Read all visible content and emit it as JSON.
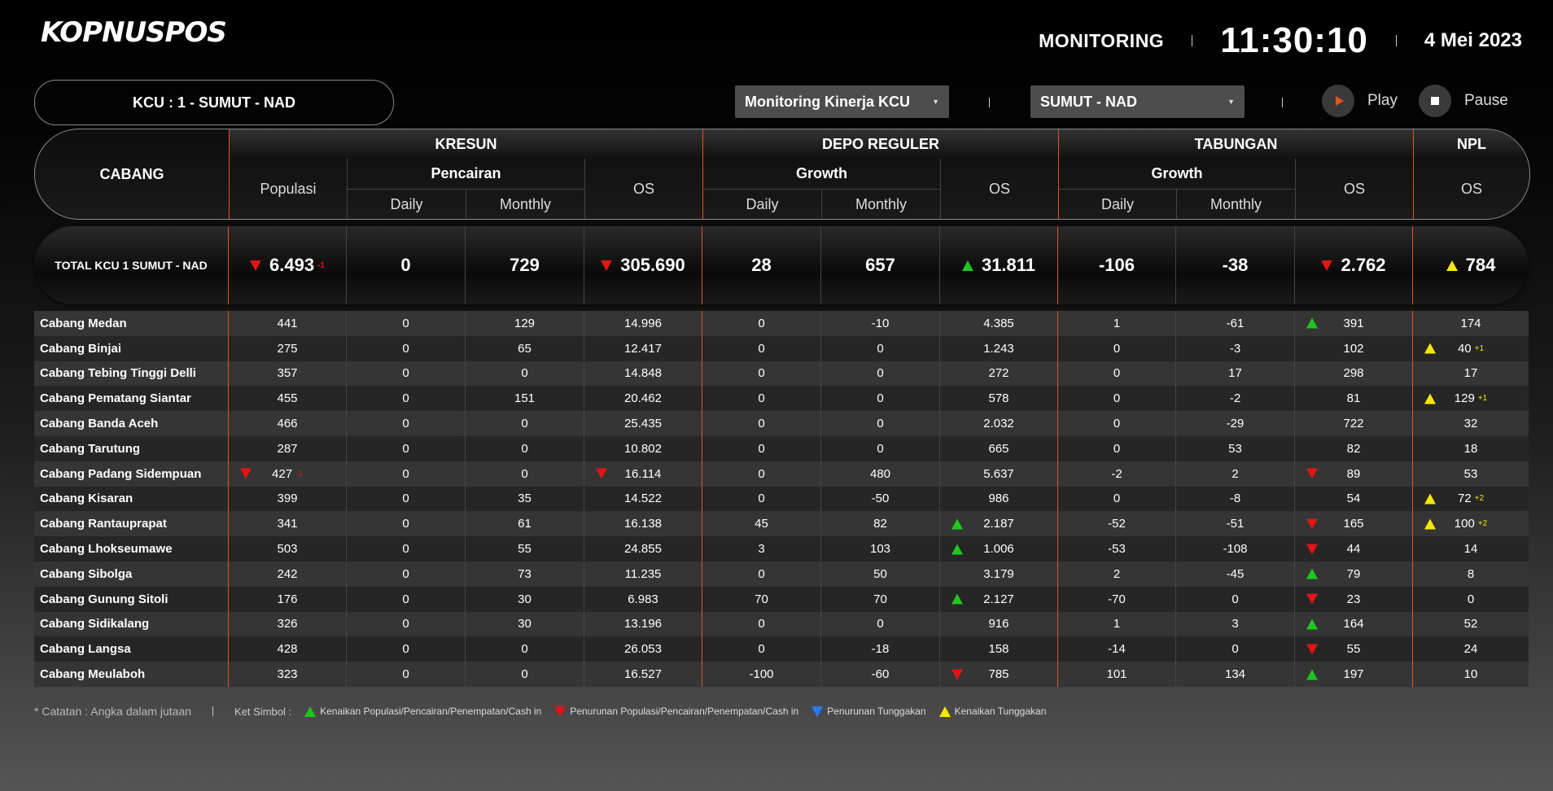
{
  "header": {
    "logo": "KOPNUSPOS",
    "monitoring_label": "MONITORING",
    "clock": "11:30:10",
    "date": "4 Mei 2023"
  },
  "toolbar": {
    "kcu_label": "KCU : 1 - SUMUT - NAD",
    "view_select": "Monitoring Kinerja KCU",
    "region_select": "SUMUT - NAD",
    "play_label": "Play",
    "pause_label": "Pause"
  },
  "table_header": {
    "cabang": "CABANG",
    "kresun": "KRESUN",
    "depo_reguler": "DEPO REGULER",
    "tabungan": "TABUNGAN",
    "npl": "NPL",
    "populasi": "Populasi",
    "pencairan": "Pencairan",
    "growth_depo": "Growth",
    "growth_tab": "Growth",
    "os": "OS",
    "daily": "Daily",
    "monthly": "Monthly"
  },
  "total": {
    "label": "TOTAL KCU 1 SUMUT - NAD",
    "values": [
      {
        "v": "6.493",
        "ind": "dn",
        "d": "-1"
      },
      {
        "v": "0"
      },
      {
        "v": "729"
      },
      {
        "v": "305.690",
        "ind": "dn"
      },
      {
        "v": "28"
      },
      {
        "v": "657"
      },
      {
        "v": "31.811",
        "ind": "up"
      },
      {
        "v": "-106"
      },
      {
        "v": "-38"
      },
      {
        "v": "2.762",
        "ind": "dn"
      },
      {
        "v": "784",
        "ind": "yl"
      }
    ]
  },
  "rows": [
    {
      "name": "Cabang Medan",
      "c": [
        {
          "v": "441"
        },
        {
          "v": "0"
        },
        {
          "v": "129"
        },
        {
          "v": "14.996"
        },
        {
          "v": "0"
        },
        {
          "v": "-10"
        },
        {
          "v": "4.385"
        },
        {
          "v": "1"
        },
        {
          "v": "-61"
        },
        {
          "v": "391",
          "ind": "up"
        },
        {
          "v": "174"
        }
      ]
    },
    {
      "name": "Cabang Binjai",
      "c": [
        {
          "v": "275"
        },
        {
          "v": "0"
        },
        {
          "v": "65"
        },
        {
          "v": "12.417"
        },
        {
          "v": "0"
        },
        {
          "v": "0"
        },
        {
          "v": "1.243"
        },
        {
          "v": "0"
        },
        {
          "v": "-3"
        },
        {
          "v": "102"
        },
        {
          "v": "40",
          "ind": "yl",
          "d": "+1"
        }
      ]
    },
    {
      "name": "Cabang Tebing Tinggi Delli",
      "c": [
        {
          "v": "357"
        },
        {
          "v": "0"
        },
        {
          "v": "0"
        },
        {
          "v": "14.848"
        },
        {
          "v": "0"
        },
        {
          "v": "0"
        },
        {
          "v": "272"
        },
        {
          "v": "0"
        },
        {
          "v": "17"
        },
        {
          "v": "298"
        },
        {
          "v": "17"
        }
      ]
    },
    {
      "name": "Cabang Pematang Siantar",
      "c": [
        {
          "v": "455"
        },
        {
          "v": "0"
        },
        {
          "v": "151"
        },
        {
          "v": "20.462"
        },
        {
          "v": "0"
        },
        {
          "v": "0"
        },
        {
          "v": "578"
        },
        {
          "v": "0"
        },
        {
          "v": "-2"
        },
        {
          "v": "81"
        },
        {
          "v": "129",
          "ind": "yl",
          "d": "+1"
        }
      ]
    },
    {
      "name": "Cabang Banda Aceh",
      "c": [
        {
          "v": "466"
        },
        {
          "v": "0"
        },
        {
          "v": "0"
        },
        {
          "v": "25.435"
        },
        {
          "v": "0"
        },
        {
          "v": "0"
        },
        {
          "v": "2.032"
        },
        {
          "v": "0"
        },
        {
          "v": "-29"
        },
        {
          "v": "722"
        },
        {
          "v": "32"
        }
      ]
    },
    {
      "name": "Cabang Tarutung",
      "c": [
        {
          "v": "287"
        },
        {
          "v": "0"
        },
        {
          "v": "0"
        },
        {
          "v": "10.802"
        },
        {
          "v": "0"
        },
        {
          "v": "0"
        },
        {
          "v": "665"
        },
        {
          "v": "0"
        },
        {
          "v": "53"
        },
        {
          "v": "82"
        },
        {
          "v": "18"
        }
      ]
    },
    {
      "name": "Cabang Padang Sidempuan",
      "c": [
        {
          "v": "427",
          "ind": "dn",
          "d": "-1"
        },
        {
          "v": "0"
        },
        {
          "v": "0"
        },
        {
          "v": "16.114",
          "ind": "dn"
        },
        {
          "v": "0"
        },
        {
          "v": "480"
        },
        {
          "v": "5.637"
        },
        {
          "v": "-2"
        },
        {
          "v": "2"
        },
        {
          "v": "89",
          "ind": "dn"
        },
        {
          "v": "53"
        }
      ]
    },
    {
      "name": "Cabang Kisaran",
      "c": [
        {
          "v": "399"
        },
        {
          "v": "0"
        },
        {
          "v": "35"
        },
        {
          "v": "14.522"
        },
        {
          "v": "0"
        },
        {
          "v": "-50"
        },
        {
          "v": "986"
        },
        {
          "v": "0"
        },
        {
          "v": "-8"
        },
        {
          "v": "54"
        },
        {
          "v": "72",
          "ind": "yl",
          "d": "+2"
        }
      ]
    },
    {
      "name": "Cabang Rantauprapat",
      "c": [
        {
          "v": "341"
        },
        {
          "v": "0"
        },
        {
          "v": "61"
        },
        {
          "v": "16.138"
        },
        {
          "v": "45"
        },
        {
          "v": "82"
        },
        {
          "v": "2.187",
          "ind": "up"
        },
        {
          "v": "-52"
        },
        {
          "v": "-51"
        },
        {
          "v": "165",
          "ind": "dn"
        },
        {
          "v": "100",
          "ind": "yl",
          "d": "+2"
        }
      ]
    },
    {
      "name": "Cabang Lhokseumawe",
      "c": [
        {
          "v": "503"
        },
        {
          "v": "0"
        },
        {
          "v": "55"
        },
        {
          "v": "24.855"
        },
        {
          "v": "3"
        },
        {
          "v": "103"
        },
        {
          "v": "1.006",
          "ind": "up"
        },
        {
          "v": "-53"
        },
        {
          "v": "-108"
        },
        {
          "v": "44",
          "ind": "dn"
        },
        {
          "v": "14"
        }
      ]
    },
    {
      "name": "Cabang Sibolga",
      "c": [
        {
          "v": "242"
        },
        {
          "v": "0"
        },
        {
          "v": "73"
        },
        {
          "v": "11.235"
        },
        {
          "v": "0"
        },
        {
          "v": "50"
        },
        {
          "v": "3.179"
        },
        {
          "v": "2"
        },
        {
          "v": "-45"
        },
        {
          "v": "79",
          "ind": "up"
        },
        {
          "v": "8"
        }
      ]
    },
    {
      "name": "Cabang Gunung Sitoli",
      "c": [
        {
          "v": "176"
        },
        {
          "v": "0"
        },
        {
          "v": "30"
        },
        {
          "v": "6.983"
        },
        {
          "v": "70"
        },
        {
          "v": "70"
        },
        {
          "v": "2.127",
          "ind": "up"
        },
        {
          "v": "-70"
        },
        {
          "v": "0"
        },
        {
          "v": "23",
          "ind": "dn"
        },
        {
          "v": "0"
        }
      ]
    },
    {
      "name": "Cabang Sidikalang",
      "c": [
        {
          "v": "326"
        },
        {
          "v": "0"
        },
        {
          "v": "30"
        },
        {
          "v": "13.196"
        },
        {
          "v": "0"
        },
        {
          "v": "0"
        },
        {
          "v": "916"
        },
        {
          "v": "1"
        },
        {
          "v": "3"
        },
        {
          "v": "164",
          "ind": "up"
        },
        {
          "v": "52"
        }
      ]
    },
    {
      "name": "Cabang Langsa",
      "c": [
        {
          "v": "428"
        },
        {
          "v": "0"
        },
        {
          "v": "0"
        },
        {
          "v": "26.053"
        },
        {
          "v": "0"
        },
        {
          "v": "-18"
        },
        {
          "v": "158"
        },
        {
          "v": "-14"
        },
        {
          "v": "0"
        },
        {
          "v": "55",
          "ind": "dn"
        },
        {
          "v": "24"
        }
      ]
    },
    {
      "name": "Cabang Meulaboh",
      "c": [
        {
          "v": "323"
        },
        {
          "v": "0"
        },
        {
          "v": "0"
        },
        {
          "v": "16.527"
        },
        {
          "v": "-100"
        },
        {
          "v": "-60"
        },
        {
          "v": "785",
          "ind": "dn"
        },
        {
          "v": "101"
        },
        {
          "v": "134"
        },
        {
          "v": "197",
          "ind": "up"
        },
        {
          "v": "10"
        }
      ]
    }
  ],
  "legend": {
    "note": "* Catatan : Angka dalam jutaan",
    "title": "Ket Simbol :",
    "items": [
      {
        "ind": "up",
        "label": "Kenaikan Populasi/Pencairan/Penempatan/Cash in"
      },
      {
        "ind": "dn",
        "label": "Penurunan Populasi/Pencairan/Penempatan/Cash in"
      },
      {
        "ind": "bl",
        "label": "Penurunan Tunggakan"
      },
      {
        "ind": "yl",
        "label": "Kenaikan Tunggakan"
      }
    ]
  },
  "colors": {
    "accent": "#e2541c",
    "up": "#1ec71e",
    "down": "#e01515",
    "npl_up": "#f5e60a",
    "npl_down": "#2a7af5"
  }
}
